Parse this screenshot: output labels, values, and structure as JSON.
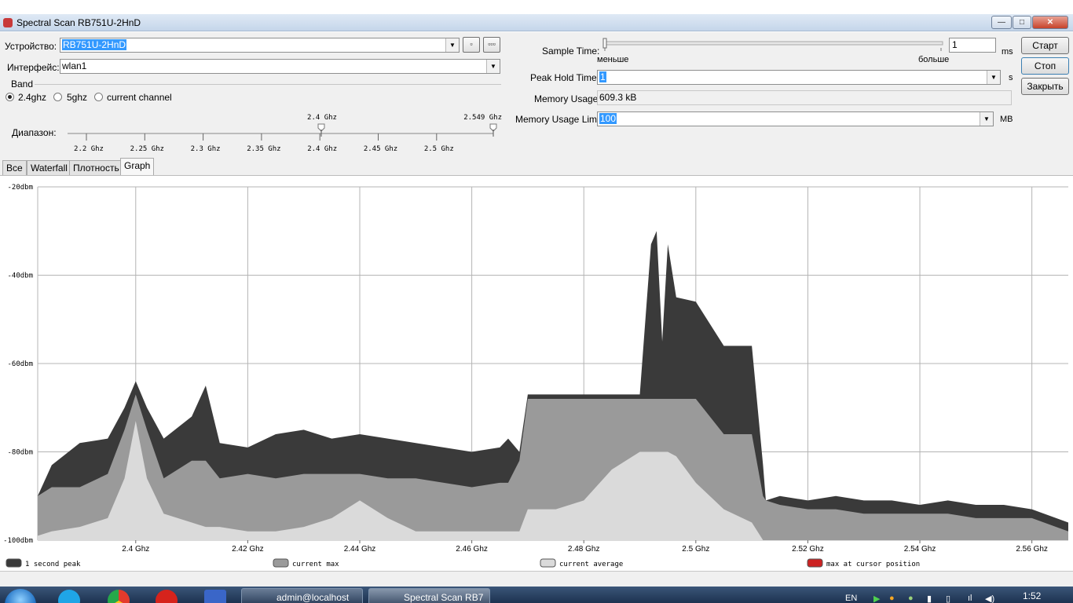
{
  "window": {
    "title": "Spectral Scan RB751U-2HnD",
    "controls": {
      "minimize": "—",
      "maximize": "□",
      "close": "✕"
    }
  },
  "form": {
    "device_label": "Устройство:",
    "device_value": "RB751U-2HnD",
    "device_btn1": "▫",
    "device_btn2": "▫▫▫",
    "interface_label": "Интерфейс:",
    "interface_value": "wlan1",
    "band_label": "Band",
    "band_options": [
      "2.4ghz",
      "5ghz",
      "current channel"
    ],
    "band_selected": "2.4ghz",
    "range_label": "Диапазон:",
    "range_marker_low": "2.4 Ghz",
    "range_marker_high": "2.549 Ghz",
    "range_ticks": [
      "2.2 Ghz",
      "2.25 Ghz",
      "2.3 Ghz",
      "2.35 Ghz",
      "2.4 Ghz",
      "2.45 Ghz",
      "2.5 Ghz"
    ],
    "sample_time_label": "Sample Time:",
    "sample_less": "меньше",
    "sample_more": "больше",
    "sample_value": "1",
    "sample_unit": "ms",
    "peak_hold_label": "Peak Hold Time:",
    "peak_hold_value": "1",
    "peak_hold_unit": "s",
    "memory_usage_label": "Memory Usage:",
    "memory_usage_value": "609.3 kB",
    "memory_limit_label": "Memory Usage Limit:",
    "memory_limit_value": "100",
    "memory_limit_unit": "MB"
  },
  "buttons": {
    "start": "Старт",
    "stop": "Стоп",
    "close": "Закрыть"
  },
  "tabs": [
    {
      "label": "Все",
      "active": false
    },
    {
      "label": "Waterfall",
      "active": false
    },
    {
      "label": "Плотность",
      "active": false
    },
    {
      "label": "Graph",
      "active": true
    }
  ],
  "colors": {
    "peak": "#3a3a3a",
    "current_max": "#9a9a9a",
    "current_average": "#dadada",
    "cursor_max": "#cc2222",
    "grid": "#b4b4b4"
  },
  "chart_data": {
    "type": "area",
    "title": "",
    "xlabel": "",
    "ylabel": "",
    "xlim": [
      2.3825,
      2.5665
    ],
    "ylim": [
      -100,
      -20
    ],
    "x_ticks": [
      2.4,
      2.42,
      2.44,
      2.46,
      2.48,
      2.5,
      2.52,
      2.54,
      2.56
    ],
    "x_tick_labels": [
      "2.4 Ghz",
      "2.42 Ghz",
      "2.44 Ghz",
      "2.46 Ghz",
      "2.48 Ghz",
      "2.5 Ghz",
      "2.52 Ghz",
      "2.54 Ghz",
      "2.56 Ghz"
    ],
    "y_ticks": [
      -20,
      -40,
      -60,
      -80,
      -100
    ],
    "y_tick_labels": [
      "-20dbm",
      "-40dbm",
      "-60dbm",
      "-80dbm",
      "-100dbm"
    ],
    "grid": true,
    "legend_placement": "bottom",
    "x": [
      2.3825,
      2.385,
      2.39,
      2.395,
      2.398,
      2.4,
      2.402,
      2.405,
      2.41,
      2.4125,
      2.415,
      2.42,
      2.425,
      2.43,
      2.435,
      2.44,
      2.445,
      2.45,
      2.455,
      2.46,
      2.465,
      2.4665,
      2.4685,
      2.47,
      2.475,
      2.48,
      2.485,
      2.49,
      2.492,
      2.493,
      2.494,
      2.495,
      2.4965,
      2.5,
      2.505,
      2.51,
      2.512,
      2.5125,
      2.515,
      2.52,
      2.525,
      2.53,
      2.535,
      2.54,
      2.545,
      2.55,
      2.555,
      2.56,
      2.5665
    ],
    "series": [
      {
        "name": "1 second peak",
        "values": [
          -90,
          -83,
          -78,
          -77,
          -70,
          -64,
          -70,
          -77,
          -72,
          -65,
          -78,
          -79,
          -76,
          -75,
          -77,
          -76,
          -77,
          -78,
          -79,
          -80,
          -79,
          -77,
          -80,
          -67,
          -67,
          -67,
          -67,
          -67,
          -33,
          -30,
          -55,
          -33,
          -45,
          -46,
          -56,
          -56,
          -83,
          -91,
          -90,
          -91,
          -90,
          -91,
          -91,
          -92,
          -91,
          -92,
          -92,
          -93,
          -96
        ]
      },
      {
        "name": "current max",
        "values": [
          -90,
          -88,
          -88,
          -85,
          -75,
          -67,
          -75,
          -86,
          -82,
          -82,
          -86,
          -85,
          -86,
          -85,
          -85,
          -85,
          -86,
          -86,
          -87,
          -88,
          -87,
          -87,
          -82,
          -68,
          -68,
          -68,
          -68,
          -68,
          -68,
          -68,
          -68,
          -68,
          -68,
          -68,
          -76,
          -76,
          -90,
          -91,
          -92,
          -93,
          -93,
          -94,
          -94,
          -94,
          -94,
          -95,
          -95,
          -95,
          -98
        ]
      },
      {
        "name": "current average",
        "values": [
          -99,
          -98,
          -97,
          -95,
          -86,
          -73,
          -86,
          -94,
          -96,
          -97,
          -97,
          -98,
          -98,
          -97,
          -95,
          -91,
          -95,
          -98,
          -98,
          -98,
          -98,
          -98,
          -98,
          -93,
          -93,
          -91,
          -84,
          -80,
          -80,
          -80,
          -80,
          -80,
          -81,
          -87,
          -93,
          -96,
          -100,
          -100,
          -100,
          -100,
          -100,
          -100,
          -100,
          -100,
          -100,
          -100,
          -100,
          -100,
          -100
        ]
      }
    ],
    "legend": [
      "1 second peak",
      "current max",
      "current average",
      "max at cursor position"
    ]
  },
  "taskbar": {
    "tasks": [
      "admin@localhost",
      "Spectral Scan RB7"
    ],
    "language": "EN",
    "clock": "1:52"
  }
}
